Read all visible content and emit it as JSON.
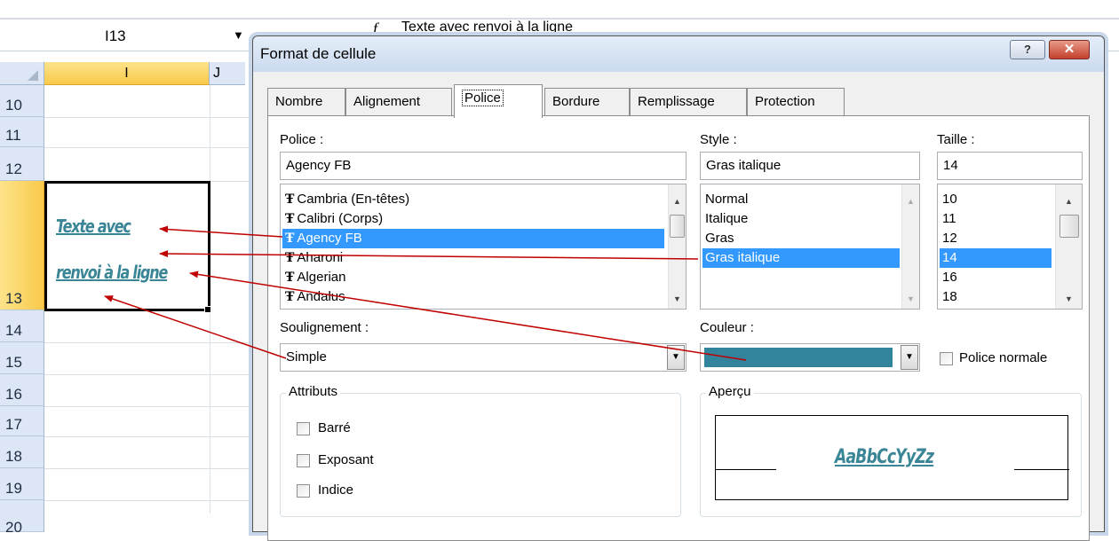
{
  "excel": {
    "name_box": "I13",
    "name_box_arrow": "▼",
    "formula_fx": "f",
    "formula_text": "Texte avec renvoi à la ligne",
    "column_i": "I",
    "column_j": "J",
    "rows": [
      "10",
      "11",
      "12",
      "13",
      "14",
      "15",
      "16",
      "17",
      "18",
      "19",
      "20"
    ],
    "cell_line1": "Texte avec",
    "cell_line2": "renvoi à la ligne"
  },
  "dialog": {
    "title": "Format de cellule",
    "help_label": "?",
    "close_label": "✕",
    "tabs": [
      "Nombre",
      "Alignement",
      "Police",
      "Bordure",
      "Remplissage",
      "Protection"
    ],
    "active_tab": "Police",
    "police": {
      "label": "Police :",
      "value": "Agency FB",
      "items": [
        {
          "icon": "Ŧ",
          "label": "Cambria (En-têtes)"
        },
        {
          "icon": "Ŧ",
          "label": "Calibri (Corps)"
        },
        {
          "icon": "Ŧ",
          "label": "Agency FB"
        },
        {
          "icon": "Ŧ",
          "label": "Aharoni"
        },
        {
          "icon": "Ŧ",
          "label": "Algerian"
        },
        {
          "icon": "Ŧ",
          "label": "Andalus"
        }
      ],
      "selected_index": 2
    },
    "style": {
      "label": "Style :",
      "value": "Gras italique",
      "items": [
        "Normal",
        "Italique",
        "Gras",
        "Gras italique"
      ],
      "selected_index": 3
    },
    "taille": {
      "label": "Taille :",
      "value": "14",
      "items": [
        "10",
        "11",
        "12",
        "14",
        "16",
        "18"
      ],
      "selected_index": 3
    },
    "soulignement": {
      "label": "Soulignement :",
      "value": "Simple"
    },
    "couleur": {
      "label": "Couleur :",
      "swatch": "#31849b"
    },
    "police_normale": "Police normale",
    "attributs": {
      "label": "Attributs",
      "items": [
        "Barré",
        "Exposant",
        "Indice"
      ]
    },
    "apercu": {
      "label": "Aperçu",
      "sample": "AaBbCcYyZz"
    }
  },
  "colors": {
    "accent": "#3399ff",
    "text_color": "#3a8696",
    "arrow": "#c00000"
  }
}
